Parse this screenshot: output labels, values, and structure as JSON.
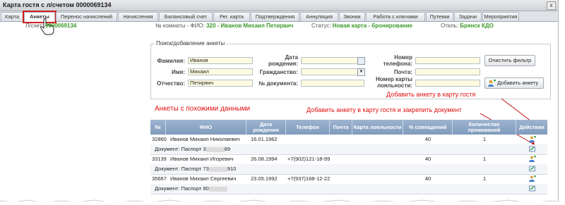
{
  "window": {
    "title": "Карта гостя с л/счетом 0000069134",
    "close": "x"
  },
  "tabs": [
    {
      "label": "Карта"
    },
    {
      "label": "Анкеты"
    },
    {
      "label": "Перенос начислений"
    },
    {
      "label": "Начисления"
    },
    {
      "label": "Балансовый счет"
    },
    {
      "label": "Рег. карта"
    },
    {
      "label": "Подтверждения"
    },
    {
      "label": "Аннуляция"
    },
    {
      "label": "Звонки"
    },
    {
      "label": "Работа с ключами"
    },
    {
      "label": "Путевки"
    },
    {
      "label": "Задачи"
    },
    {
      "label": "Мероприятия"
    }
  ],
  "info": {
    "account_label": "Л/счет:",
    "account_value": "0000069134",
    "room_label": "№ комнаты - ФИО:",
    "room_value": "320 - Иванов Михаил Петирвич",
    "status_label": "Статус:",
    "status_value": "Новая карта - бронирование",
    "hotel_label": "Отель:",
    "hotel_value": "Брянск КДО"
  },
  "search": {
    "legend": "Поиск/добавление анкеты",
    "surname_label": "Фамилия:",
    "surname_value": "Иванов",
    "name_label": "Имя:",
    "name_value": "Михаил",
    "patronymic_label": "Отчество:",
    "patronymic_value": "Петирвич",
    "birthdate_label": "Дата рождения:",
    "citizenship_label": "Гражданство:",
    "document_label": "№ документа:",
    "phone_label": "Номер телефона:",
    "email_label": "Почта:",
    "loyalty_label": "Номер карты лояльности:",
    "clear_filter": "Очистить фильтр",
    "add_profile": "Добавить анкету"
  },
  "annotations": {
    "add_to_card": "Добавить анкету в карту гостя",
    "add_and_attach": "Добавить анкету в карту гостя и закрепить документ"
  },
  "results_title": "Анкеты с похожими данными",
  "table": {
    "headers": [
      "№",
      "ФИО",
      "Дата рождения",
      "Телефон",
      "Почта",
      "Карта лояльности",
      "% совпадений",
      "Количество проживаний",
      "Действия"
    ],
    "rows": [
      {
        "num": "32860",
        "fio": "Иванов Михаил Николаевич",
        "birth": "16.01.1962",
        "phone": "",
        "email": "",
        "loyalty": "",
        "match": "40",
        "stays": "1",
        "doc": "Документ: Паспорт 3",
        "doc_tail": "89"
      },
      {
        "num": "33139",
        "fio": "Иванов Михаил Игоревич",
        "birth": "26.08.1994",
        "phone": "+7(902)121-18-99",
        "email": "",
        "loyalty": "",
        "match": "40",
        "stays": "1",
        "doc": "Документ: Паспорт 73",
        "doc_tail": "910"
      },
      {
        "num": "35667",
        "fio": "Иванов Михаил Сергеевич",
        "birth": "23.05.1992",
        "phone": "+7(937)168-12-22",
        "email": "",
        "loyalty": "",
        "match": "40",
        "stays": "1",
        "doc": "Документ: Паспорт 80",
        "doc_tail": ""
      }
    ]
  },
  "colors": {
    "accent_green": "#3a9a2a",
    "annotation_red": "#e01010",
    "header_blue": "#8fa9c8"
  }
}
